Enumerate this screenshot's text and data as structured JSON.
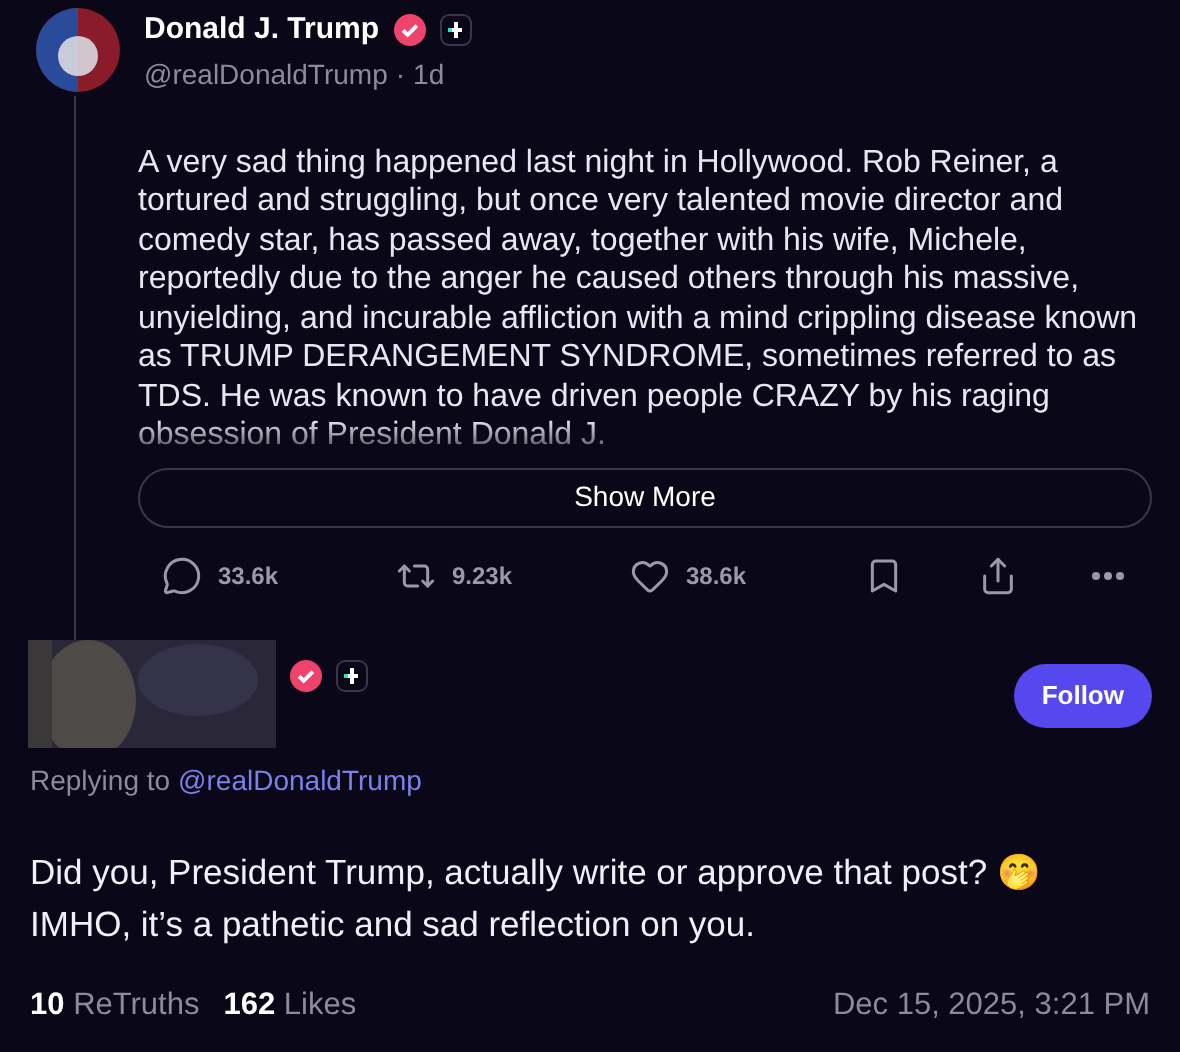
{
  "post": {
    "author": {
      "name": "Donald J. Trump",
      "handle": "@realDonaldTrump",
      "separator": "·",
      "time": "1d",
      "verified": true,
      "plus": true
    },
    "text": "A very sad thing happened last night in Hollywood. Rob Reiner, a tortured and struggling, but once very talented movie director and comedy star, has passed away, together with his wife, Michele, reportedly due to the anger he caused others through his massive, unyielding, and incurable affliction with a mind crippling disease known as TRUMP DERANGEMENT SYNDROME, sometimes referred to as TDS. He was known to have driven people CRAZY by his raging obsession of President Donald J.",
    "show_more": "Show More",
    "actions": [
      {
        "kind": "reply",
        "count": "33.6k"
      },
      {
        "kind": "retruth",
        "count": "9.23k"
      },
      {
        "kind": "like",
        "count": "38.6k"
      },
      {
        "kind": "bookmark"
      },
      {
        "kind": "share"
      },
      {
        "kind": "more"
      }
    ]
  },
  "reply": {
    "author": {
      "verified": true,
      "plus": true
    },
    "follow": "Follow",
    "replying_label": "Replying to",
    "replying_handle": "@realDonaldTrump",
    "text": "Did you, President Trump, actually write or approve that post? 🤭 IMHO, it’s a pathetic and sad reflection on you.",
    "stats": [
      {
        "count": "10",
        "label": "ReTruths"
      },
      {
        "count": "162",
        "label": "Likes"
      }
    ],
    "date": "Dec 15, 2025, 3:21 PM"
  }
}
